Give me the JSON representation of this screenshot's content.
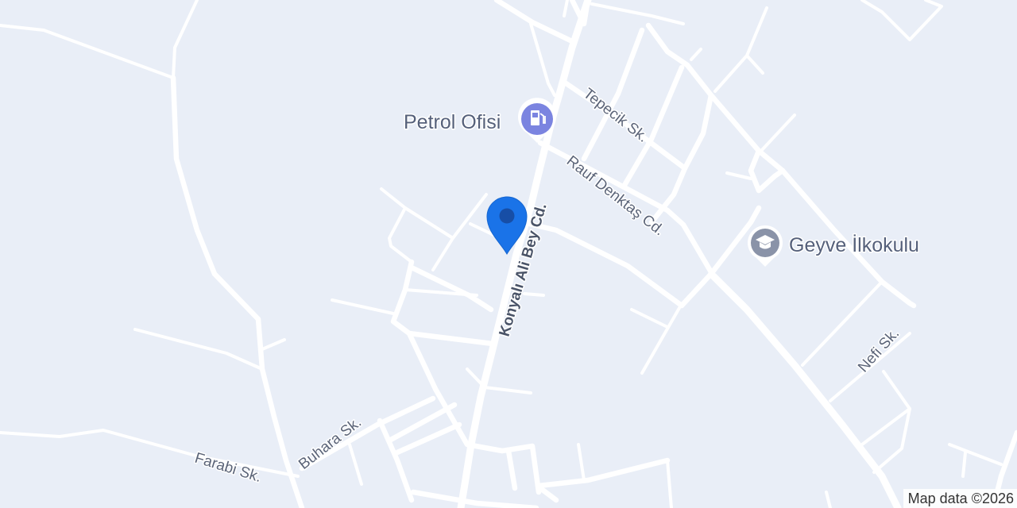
{
  "map": {
    "streets": {
      "konyali": "Konyalı Ali Bey Cd.",
      "rauf": "Rauf Denktaş Cd.",
      "tepecik": "Tepecik Sk.",
      "nefi": "Nefi Sk.",
      "buhara": "Buhara Sk.",
      "farabi": "Farabi Sk."
    },
    "pois": {
      "petrol": {
        "name": "Petrol Ofisi",
        "icon": "gas-station-icon",
        "color": "#7b84e0"
      },
      "school": {
        "name": "Geyve İlkokulu",
        "icon": "school-icon",
        "color": "#8a93a8"
      }
    },
    "pin": {
      "icon": "location-pin-icon",
      "color": "#1a73e8"
    },
    "attribution": "Map data ©2026"
  }
}
